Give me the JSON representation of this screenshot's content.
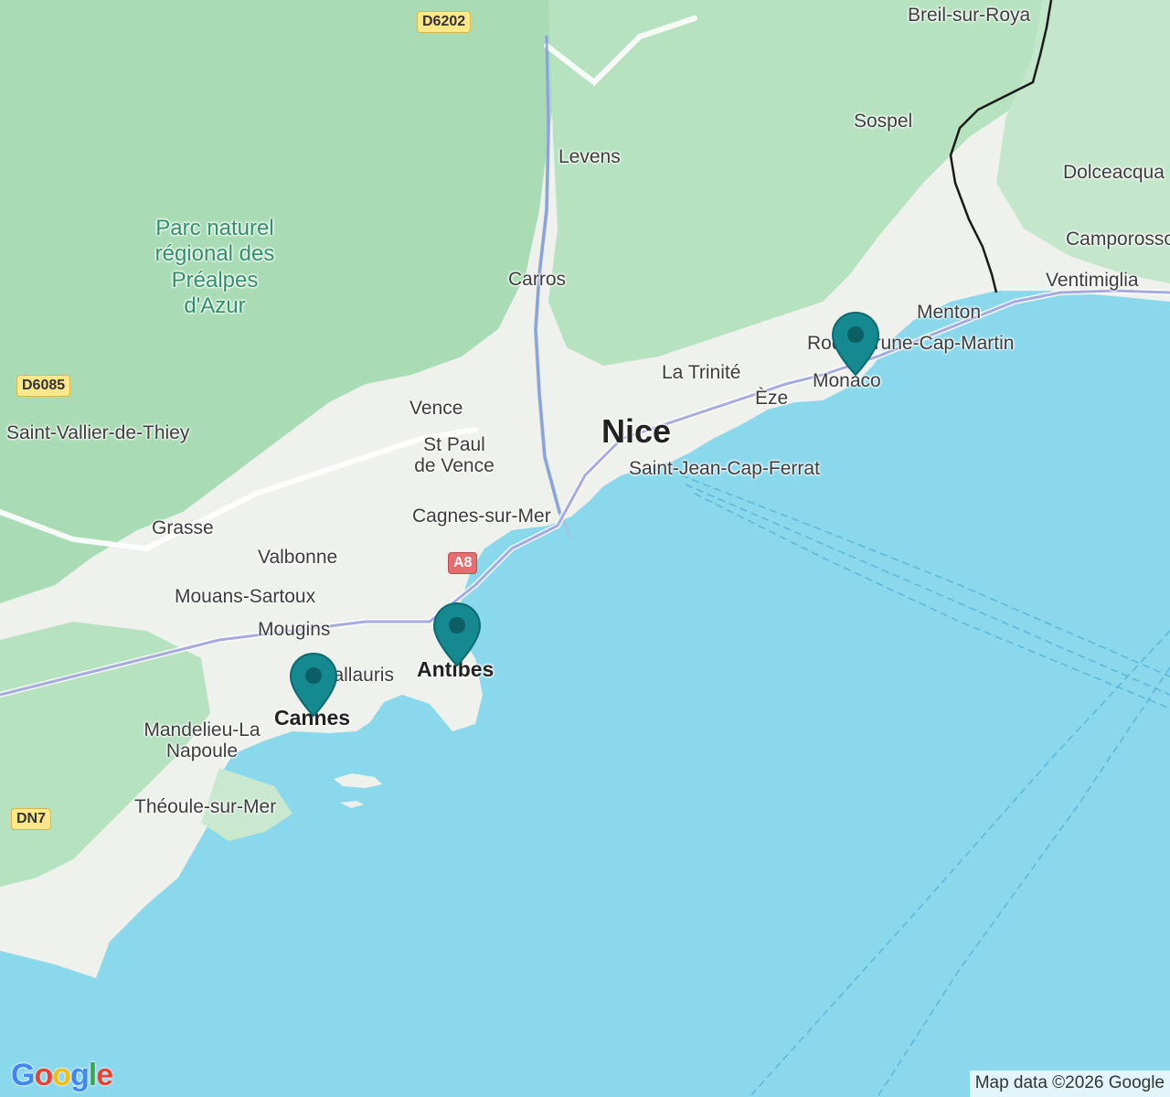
{
  "map": {
    "places": {
      "breil": "Breil-sur-Roya",
      "sospel": "Sospel",
      "levens": "Levens",
      "dolceacqua": "Dolceacqua",
      "camporosso": "Camporosso",
      "ventimiglia": "Ventimiglia",
      "carros": "Carros",
      "menton": "Menton",
      "roquebrune": "Roquebrune-Cap-Martin",
      "la_trinite": "La Trinité",
      "monaco": "Monaco",
      "eze": "Èze",
      "vence": "Vence",
      "nice": "Nice",
      "st_paul_line1": "St Paul",
      "st_paul_line2": "de Vence",
      "saint_jean": "Saint-Jean-Cap-Ferrat",
      "saint_vallier": "Saint-Vallier-de-Thiey",
      "cagnes": "Cagnes-sur-Mer",
      "grasse": "Grasse",
      "valbonne": "Valbonne",
      "mouans": "Mouans-Sartoux",
      "mougins": "Mougins",
      "vallauris": "Vallauris",
      "antibes": "Antibes",
      "cannes": "Cannes",
      "mandelieu_line1": "Mandelieu-La",
      "mandelieu_line2": "Napoule",
      "theoule": "Théoule-sur-Mer"
    },
    "park": {
      "line1": "Parc naturel",
      "line2": "régional des",
      "line3": "Préalpes",
      "line4": "d'Azur"
    },
    "roads": {
      "d6202": "D6202",
      "d6085": "D6085",
      "a8": "A8",
      "dn7": "DN7"
    },
    "markers": [
      {
        "name": "monaco-marker",
        "icon": "map-pin-icon"
      },
      {
        "name": "antibes-marker",
        "icon": "map-pin-icon"
      },
      {
        "name": "cannes-marker",
        "icon": "map-pin-icon"
      }
    ],
    "colors": {
      "sea": "#8ad8ec",
      "land": "#f2f2f0",
      "forest": "#a9dcb4",
      "marker": "#14898f",
      "border": "#1a1a1a"
    }
  },
  "footer": {
    "logo": [
      "G",
      "o",
      "o",
      "g",
      "l",
      "e"
    ],
    "logo_colors": [
      "#4285f4",
      "#ea4335",
      "#fbbc05",
      "#4285f4",
      "#34a853",
      "#ea4335"
    ],
    "attribution": "Map data ©2026 Google"
  }
}
